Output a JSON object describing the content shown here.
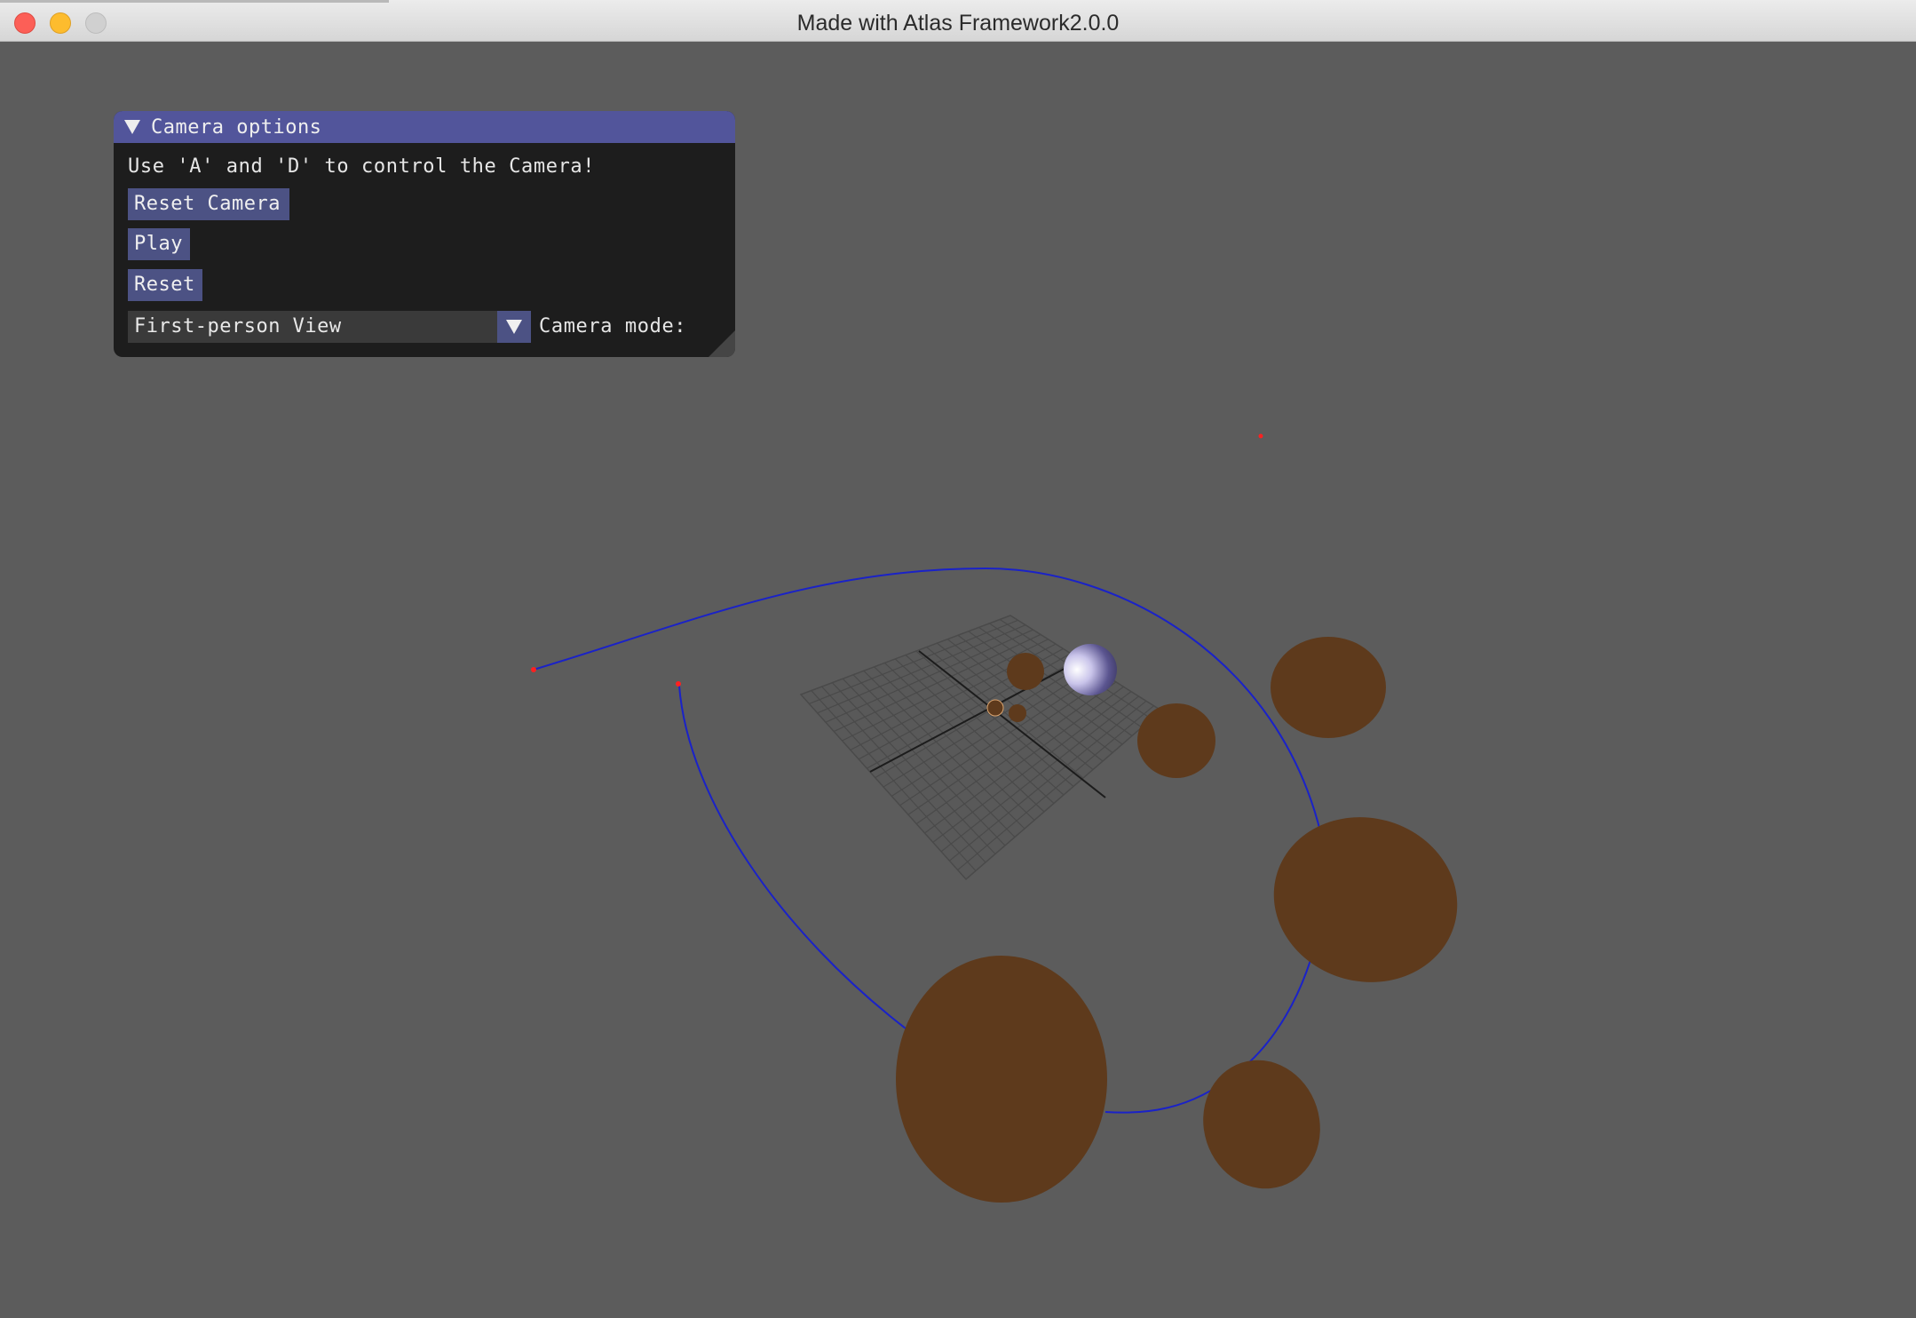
{
  "window": {
    "title": "Made with Atlas Framework2.0.0"
  },
  "panel": {
    "title": "Camera options",
    "instructions": "Use 'A' and 'D' to control the Camera!",
    "buttons": {
      "reset_camera": "Reset Camera",
      "play": "Play",
      "reset": "Reset"
    },
    "camera_mode": {
      "selected": "First-person View",
      "label": "Camera mode:"
    }
  },
  "colors": {
    "background": "#5c5c5c",
    "panel_header": "#52559b",
    "button": "#4c5284",
    "spline": "#1a22c8",
    "control_point": "#ff2020",
    "planet_brown": "#5e3a1c",
    "highlight_sphere": "#d4d0f0"
  }
}
